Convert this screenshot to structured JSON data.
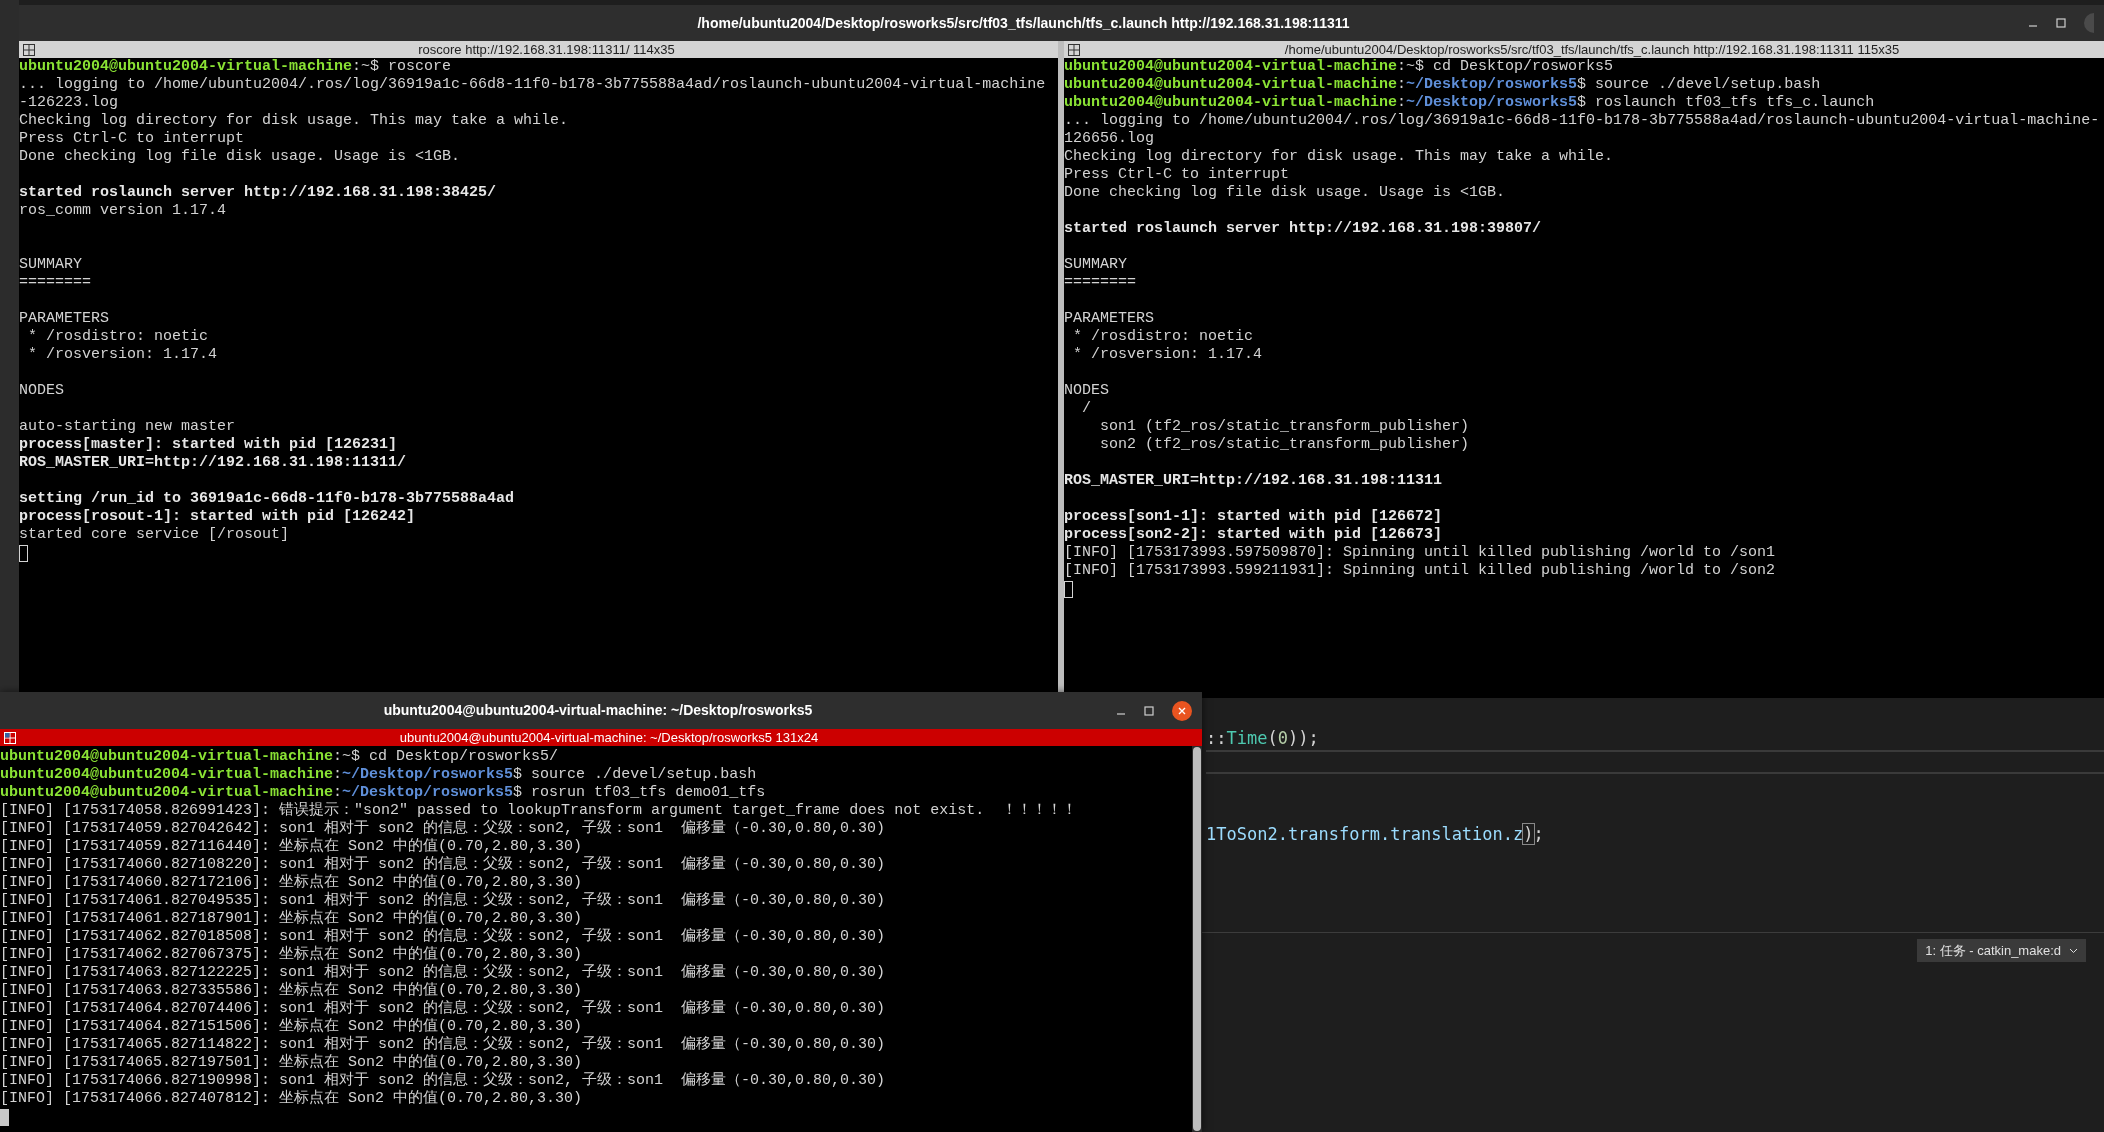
{
  "top_window": {
    "title": "/home/ubuntu2004/Desktop/rosworks5/src/tf03_tfs/launch/tfs_c.launch http://192.168.31.198:11311",
    "panes": [
      {
        "header": "roscore http://192.168.31.198:11311/ 114x35",
        "focused": false,
        "lines": [
          {
            "kind": "prompt",
            "spans": [
              {
                "kind": "user",
                "text": "ubuntu2004@ubuntu2004-virtual-machine"
              },
              {
                "kind": "plain",
                "text": ":~$ roscore"
              }
            ]
          },
          {
            "kind": "plain",
            "text": "... logging to /home/ubuntu2004/.ros/log/36919a1c-66d8-11f0-b178-3b775588a4ad/roslaunch-ubuntu2004-virtual-machine"
          },
          {
            "kind": "plain",
            "text": "-126223.log"
          },
          {
            "kind": "plain",
            "text": "Checking log directory for disk usage. This may take a while."
          },
          {
            "kind": "plain",
            "text": "Press Ctrl-C to interrupt"
          },
          {
            "kind": "plain",
            "text": "Done checking log file disk usage. Usage is <1GB."
          },
          {
            "kind": "blank"
          },
          {
            "kind": "bold",
            "text": "started roslaunch server http://192.168.31.198:38425/"
          },
          {
            "kind": "plain",
            "text": "ros_comm version 1.17.4"
          },
          {
            "kind": "blank"
          },
          {
            "kind": "blank"
          },
          {
            "kind": "plain",
            "text": "SUMMARY"
          },
          {
            "kind": "plain",
            "text": "========"
          },
          {
            "kind": "blank"
          },
          {
            "kind": "plain",
            "text": "PARAMETERS"
          },
          {
            "kind": "plain",
            "text": " * /rosdistro: noetic"
          },
          {
            "kind": "plain",
            "text": " * /rosversion: 1.17.4"
          },
          {
            "kind": "blank"
          },
          {
            "kind": "plain",
            "text": "NODES"
          },
          {
            "kind": "blank"
          },
          {
            "kind": "plain",
            "text": "auto-starting new master"
          },
          {
            "kind": "bold",
            "text": "process[master]: started with pid [126231]"
          },
          {
            "kind": "bold",
            "text": "ROS_MASTER_URI=http://192.168.31.198:11311/"
          },
          {
            "kind": "blank"
          },
          {
            "kind": "bold",
            "text": "setting /run_id to 36919a1c-66d8-11f0-b178-3b775588a4ad"
          },
          {
            "kind": "bold",
            "text": "process[rosout-1]: started with pid [126242]"
          },
          {
            "kind": "plain",
            "text": "started core service [/rosout]"
          }
        ]
      },
      {
        "header": "/home/ubuntu2004/Desktop/rosworks5/src/tf03_tfs/launch/tfs_c.launch http://192.168.31.198:11311 115x35",
        "focused": false,
        "lines": [
          {
            "kind": "prompt",
            "spans": [
              {
                "kind": "user",
                "text": "ubuntu2004@ubuntu2004-virtual-machine"
              },
              {
                "kind": "plain",
                "text": ":~$ cd Desktop/rosworks5"
              }
            ]
          },
          {
            "kind": "prompt",
            "spans": [
              {
                "kind": "user",
                "text": "ubuntu2004@ubuntu2004-virtual-machine"
              },
              {
                "kind": "plain",
                "text": ":"
              },
              {
                "kind": "path",
                "text": "~/Desktop/rosworks5"
              },
              {
                "kind": "plain",
                "text": "$ source ./devel/setup.bash"
              }
            ]
          },
          {
            "kind": "prompt",
            "spans": [
              {
                "kind": "user",
                "text": "ubuntu2004@ubuntu2004-virtual-machine"
              },
              {
                "kind": "plain",
                "text": ":"
              },
              {
                "kind": "path",
                "text": "~/Desktop/rosworks5"
              },
              {
                "kind": "plain",
                "text": "$ roslaunch tf03_tfs tfs_c.launch"
              }
            ]
          },
          {
            "kind": "plain",
            "text": "... logging to /home/ubuntu2004/.ros/log/36919a1c-66d8-11f0-b178-3b775588a4ad/roslaunch-ubuntu2004-virtual-machine-"
          },
          {
            "kind": "plain",
            "text": "126656.log"
          },
          {
            "kind": "plain",
            "text": "Checking log directory for disk usage. This may take a while."
          },
          {
            "kind": "plain",
            "text": "Press Ctrl-C to interrupt"
          },
          {
            "kind": "plain",
            "text": "Done checking log file disk usage. Usage is <1GB."
          },
          {
            "kind": "blank"
          },
          {
            "kind": "bold",
            "text": "started roslaunch server http://192.168.31.198:39807/"
          },
          {
            "kind": "blank"
          },
          {
            "kind": "plain",
            "text": "SUMMARY"
          },
          {
            "kind": "plain",
            "text": "========"
          },
          {
            "kind": "blank"
          },
          {
            "kind": "plain",
            "text": "PARAMETERS"
          },
          {
            "kind": "plain",
            "text": " * /rosdistro: noetic"
          },
          {
            "kind": "plain",
            "text": " * /rosversion: 1.17.4"
          },
          {
            "kind": "blank"
          },
          {
            "kind": "plain",
            "text": "NODES"
          },
          {
            "kind": "plain",
            "text": "  /"
          },
          {
            "kind": "plain",
            "text": "    son1 (tf2_ros/static_transform_publisher)"
          },
          {
            "kind": "plain",
            "text": "    son2 (tf2_ros/static_transform_publisher)"
          },
          {
            "kind": "blank"
          },
          {
            "kind": "bold",
            "text": "ROS_MASTER_URI=http://192.168.31.198:11311"
          },
          {
            "kind": "blank"
          },
          {
            "kind": "bold",
            "text": "process[son1-1]: started with pid [126672]"
          },
          {
            "kind": "bold",
            "text": "process[son2-2]: started with pid [126673]"
          },
          {
            "kind": "plain",
            "text": "[INFO] [1753173993.597509870]: Spinning until killed publishing /world to /son1"
          },
          {
            "kind": "plain",
            "text": "[INFO] [1753173993.599211931]: Spinning until killed publishing /world to /son2"
          }
        ]
      }
    ]
  },
  "editor": {
    "lines": [
      {
        "kind": "code",
        "current": false,
        "spans": [
          {
            "kind": "punct",
            "text": "::"
          },
          {
            "kind": "type",
            "text": "Time"
          },
          {
            "kind": "punct",
            "text": "("
          },
          {
            "kind": "number",
            "text": "0"
          },
          {
            "kind": "punct",
            "text": "));"
          }
        ]
      },
      {
        "kind": "blank",
        "current": true
      },
      {
        "kind": "blank",
        "current": false
      },
      {
        "kind": "blank",
        "current": false
      },
      {
        "kind": "code",
        "current": false,
        "spans": [
          {
            "kind": "variable",
            "text": "1ToSon2.transform.translation.z"
          },
          {
            "kind": "bracket",
            "text": ")"
          },
          {
            "kind": "punct",
            "text": ";"
          }
        ]
      }
    ],
    "task_dropdown": "1: 任务 - catkin_make:d"
  },
  "bottom_window": {
    "title": "ubuntu2004@ubuntu2004-virtual-machine: ~/Desktop/rosworks5",
    "header": "ubuntu2004@ubuntu2004-virtual-machine: ~/Desktop/rosworks5 131x24",
    "focused": true,
    "lines": [
      {
        "kind": "prompt",
        "spans": [
          {
            "kind": "user",
            "text": "ubuntu2004@ubuntu2004-virtual-machine"
          },
          {
            "kind": "plain",
            "text": ":~$ cd Desktop/rosworks5/"
          }
        ]
      },
      {
        "kind": "prompt",
        "spans": [
          {
            "kind": "user",
            "text": "ubuntu2004@ubuntu2004-virtual-machine"
          },
          {
            "kind": "plain",
            "text": ":"
          },
          {
            "kind": "path",
            "text": "~/Desktop/rosworks5"
          },
          {
            "kind": "plain",
            "text": "$ source ./devel/setup.bash"
          }
        ]
      },
      {
        "kind": "prompt",
        "spans": [
          {
            "kind": "user",
            "text": "ubuntu2004@ubuntu2004-virtual-machine"
          },
          {
            "kind": "plain",
            "text": ":"
          },
          {
            "kind": "path",
            "text": "~/Desktop/rosworks5"
          },
          {
            "kind": "plain",
            "text": "$ rosrun tf03_tfs demo01_tfs"
          }
        ]
      },
      {
        "kind": "plain",
        "text": "[INFO] [1753174058.826991423]: 错误提示：\"son2\" passed to lookupTransform argument target_frame does not exist.  ！！！！！"
      },
      {
        "kind": "plain",
        "text": "[INFO] [1753174059.827042642]: son1 相对于 son2 的信息：父级：son2, 子级：son1  偏移量（-0.30,0.80,0.30)"
      },
      {
        "kind": "plain",
        "text": "[INFO] [1753174059.827116440]: 坐标点在 Son2 中的值(0.70,2.80,3.30)"
      },
      {
        "kind": "plain",
        "text": "[INFO] [1753174060.827108220]: son1 相对于 son2 的信息：父级：son2, 子级：son1  偏移量（-0.30,0.80,0.30)"
      },
      {
        "kind": "plain",
        "text": "[INFO] [1753174060.827172106]: 坐标点在 Son2 中的值(0.70,2.80,3.30)"
      },
      {
        "kind": "plain",
        "text": "[INFO] [1753174061.827049535]: son1 相对于 son2 的信息：父级：son2, 子级：son1  偏移量（-0.30,0.80,0.30)"
      },
      {
        "kind": "plain",
        "text": "[INFO] [1753174061.827187901]: 坐标点在 Son2 中的值(0.70,2.80,3.30)"
      },
      {
        "kind": "plain",
        "text": "[INFO] [1753174062.827018508]: son1 相对于 son2 的信息：父级：son2, 子级：son1  偏移量（-0.30,0.80,0.30)"
      },
      {
        "kind": "plain",
        "text": "[INFO] [1753174062.827067375]: 坐标点在 Son2 中的值(0.70,2.80,3.30)"
      },
      {
        "kind": "plain",
        "text": "[INFO] [1753174063.827122225]: son1 相对于 son2 的信息：父级：son2, 子级：son1  偏移量（-0.30,0.80,0.30)"
      },
      {
        "kind": "plain",
        "text": "[INFO] [1753174063.827335586]: 坐标点在 Son2 中的值(0.70,2.80,3.30)"
      },
      {
        "kind": "plain",
        "text": "[INFO] [1753174064.827074406]: son1 相对于 son2 的信息：父级：son2, 子级：son1  偏移量（-0.30,0.80,0.30)"
      },
      {
        "kind": "plain",
        "text": "[INFO] [1753174064.827151506]: 坐标点在 Son2 中的值(0.70,2.80,3.30)"
      },
      {
        "kind": "plain",
        "text": "[INFO] [1753174065.827114822]: son1 相对于 son2 的信息：父级：son2, 子级：son1  偏移量（-0.30,0.80,0.30)"
      },
      {
        "kind": "plain",
        "text": "[INFO] [1753174065.827197501]: 坐标点在 Son2 中的值(0.70,2.80,3.30)"
      },
      {
        "kind": "plain",
        "text": "[INFO] [1753174066.827190998]: son1 相对于 son2 的信息：父级：son2, 子级：son1  偏移量（-0.30,0.80,0.30)"
      },
      {
        "kind": "plain",
        "text": "[INFO] [1753174066.827407812]: 坐标点在 Son2 中的值(0.70,2.80,3.30)"
      }
    ]
  }
}
